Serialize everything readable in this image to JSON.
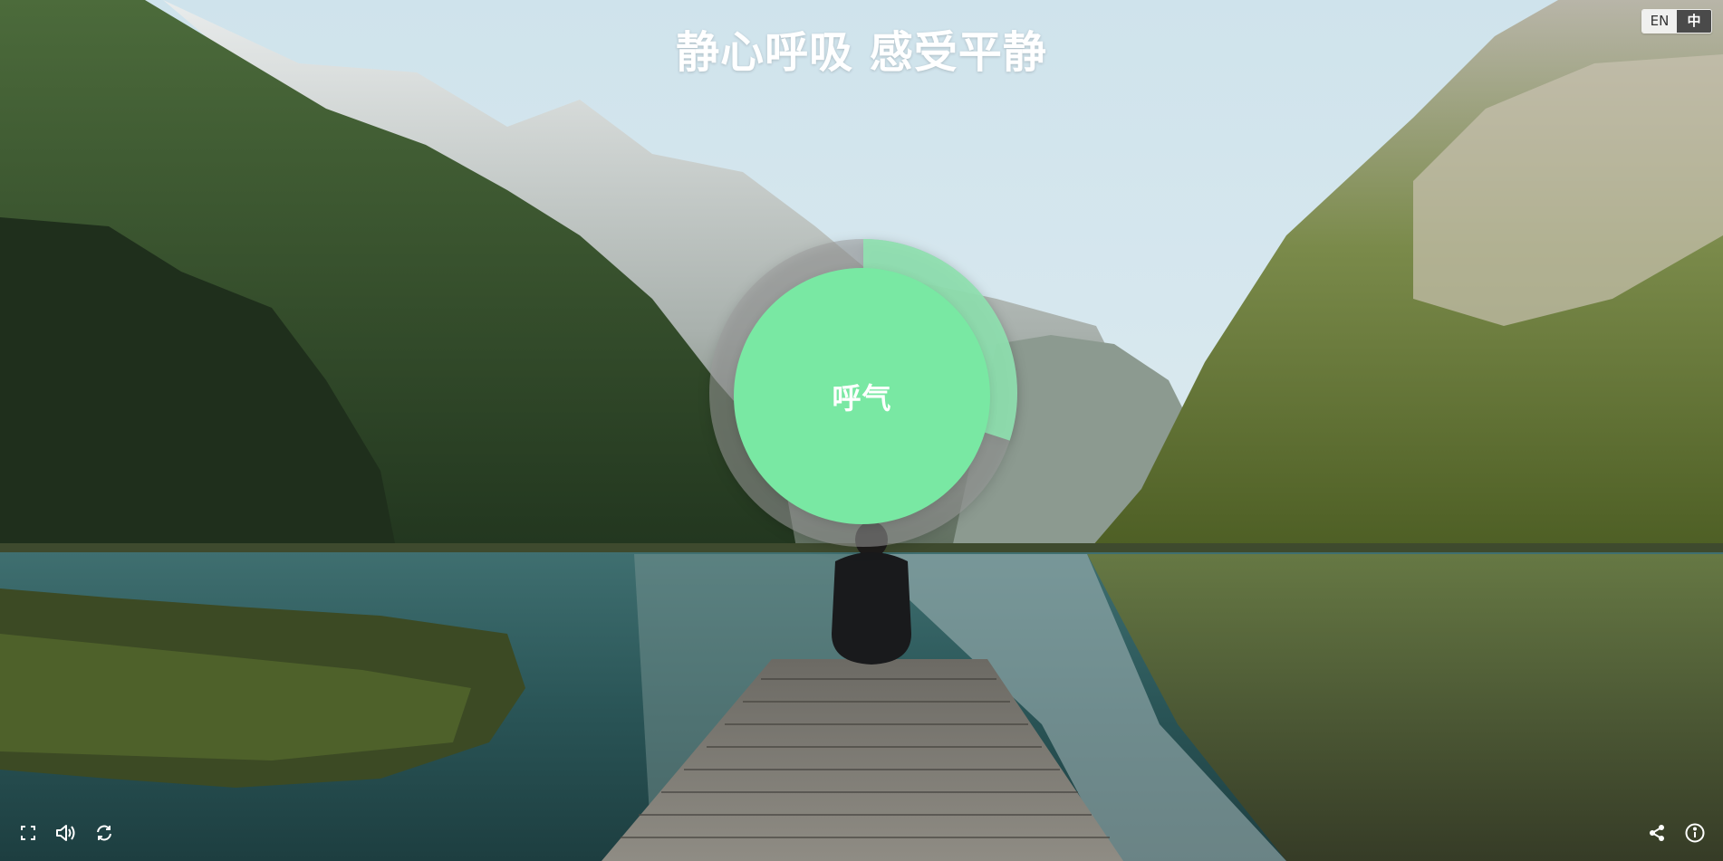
{
  "title": "静心呼吸 感受平静",
  "language": {
    "options": [
      "EN",
      "中"
    ],
    "selected": "中"
  },
  "breath": {
    "phase_label": "呼气",
    "progress": 0.3,
    "circle_color": "#79e8a3",
    "ring_progress_color": "#8ee6b2",
    "ring_track_color": "#9a9a9a"
  },
  "toolbar": {
    "left": [
      {
        "name": "fullscreen-icon"
      },
      {
        "name": "volume-icon"
      },
      {
        "name": "refresh-icon"
      }
    ],
    "right": [
      {
        "name": "share-icon"
      },
      {
        "name": "info-icon"
      }
    ]
  }
}
